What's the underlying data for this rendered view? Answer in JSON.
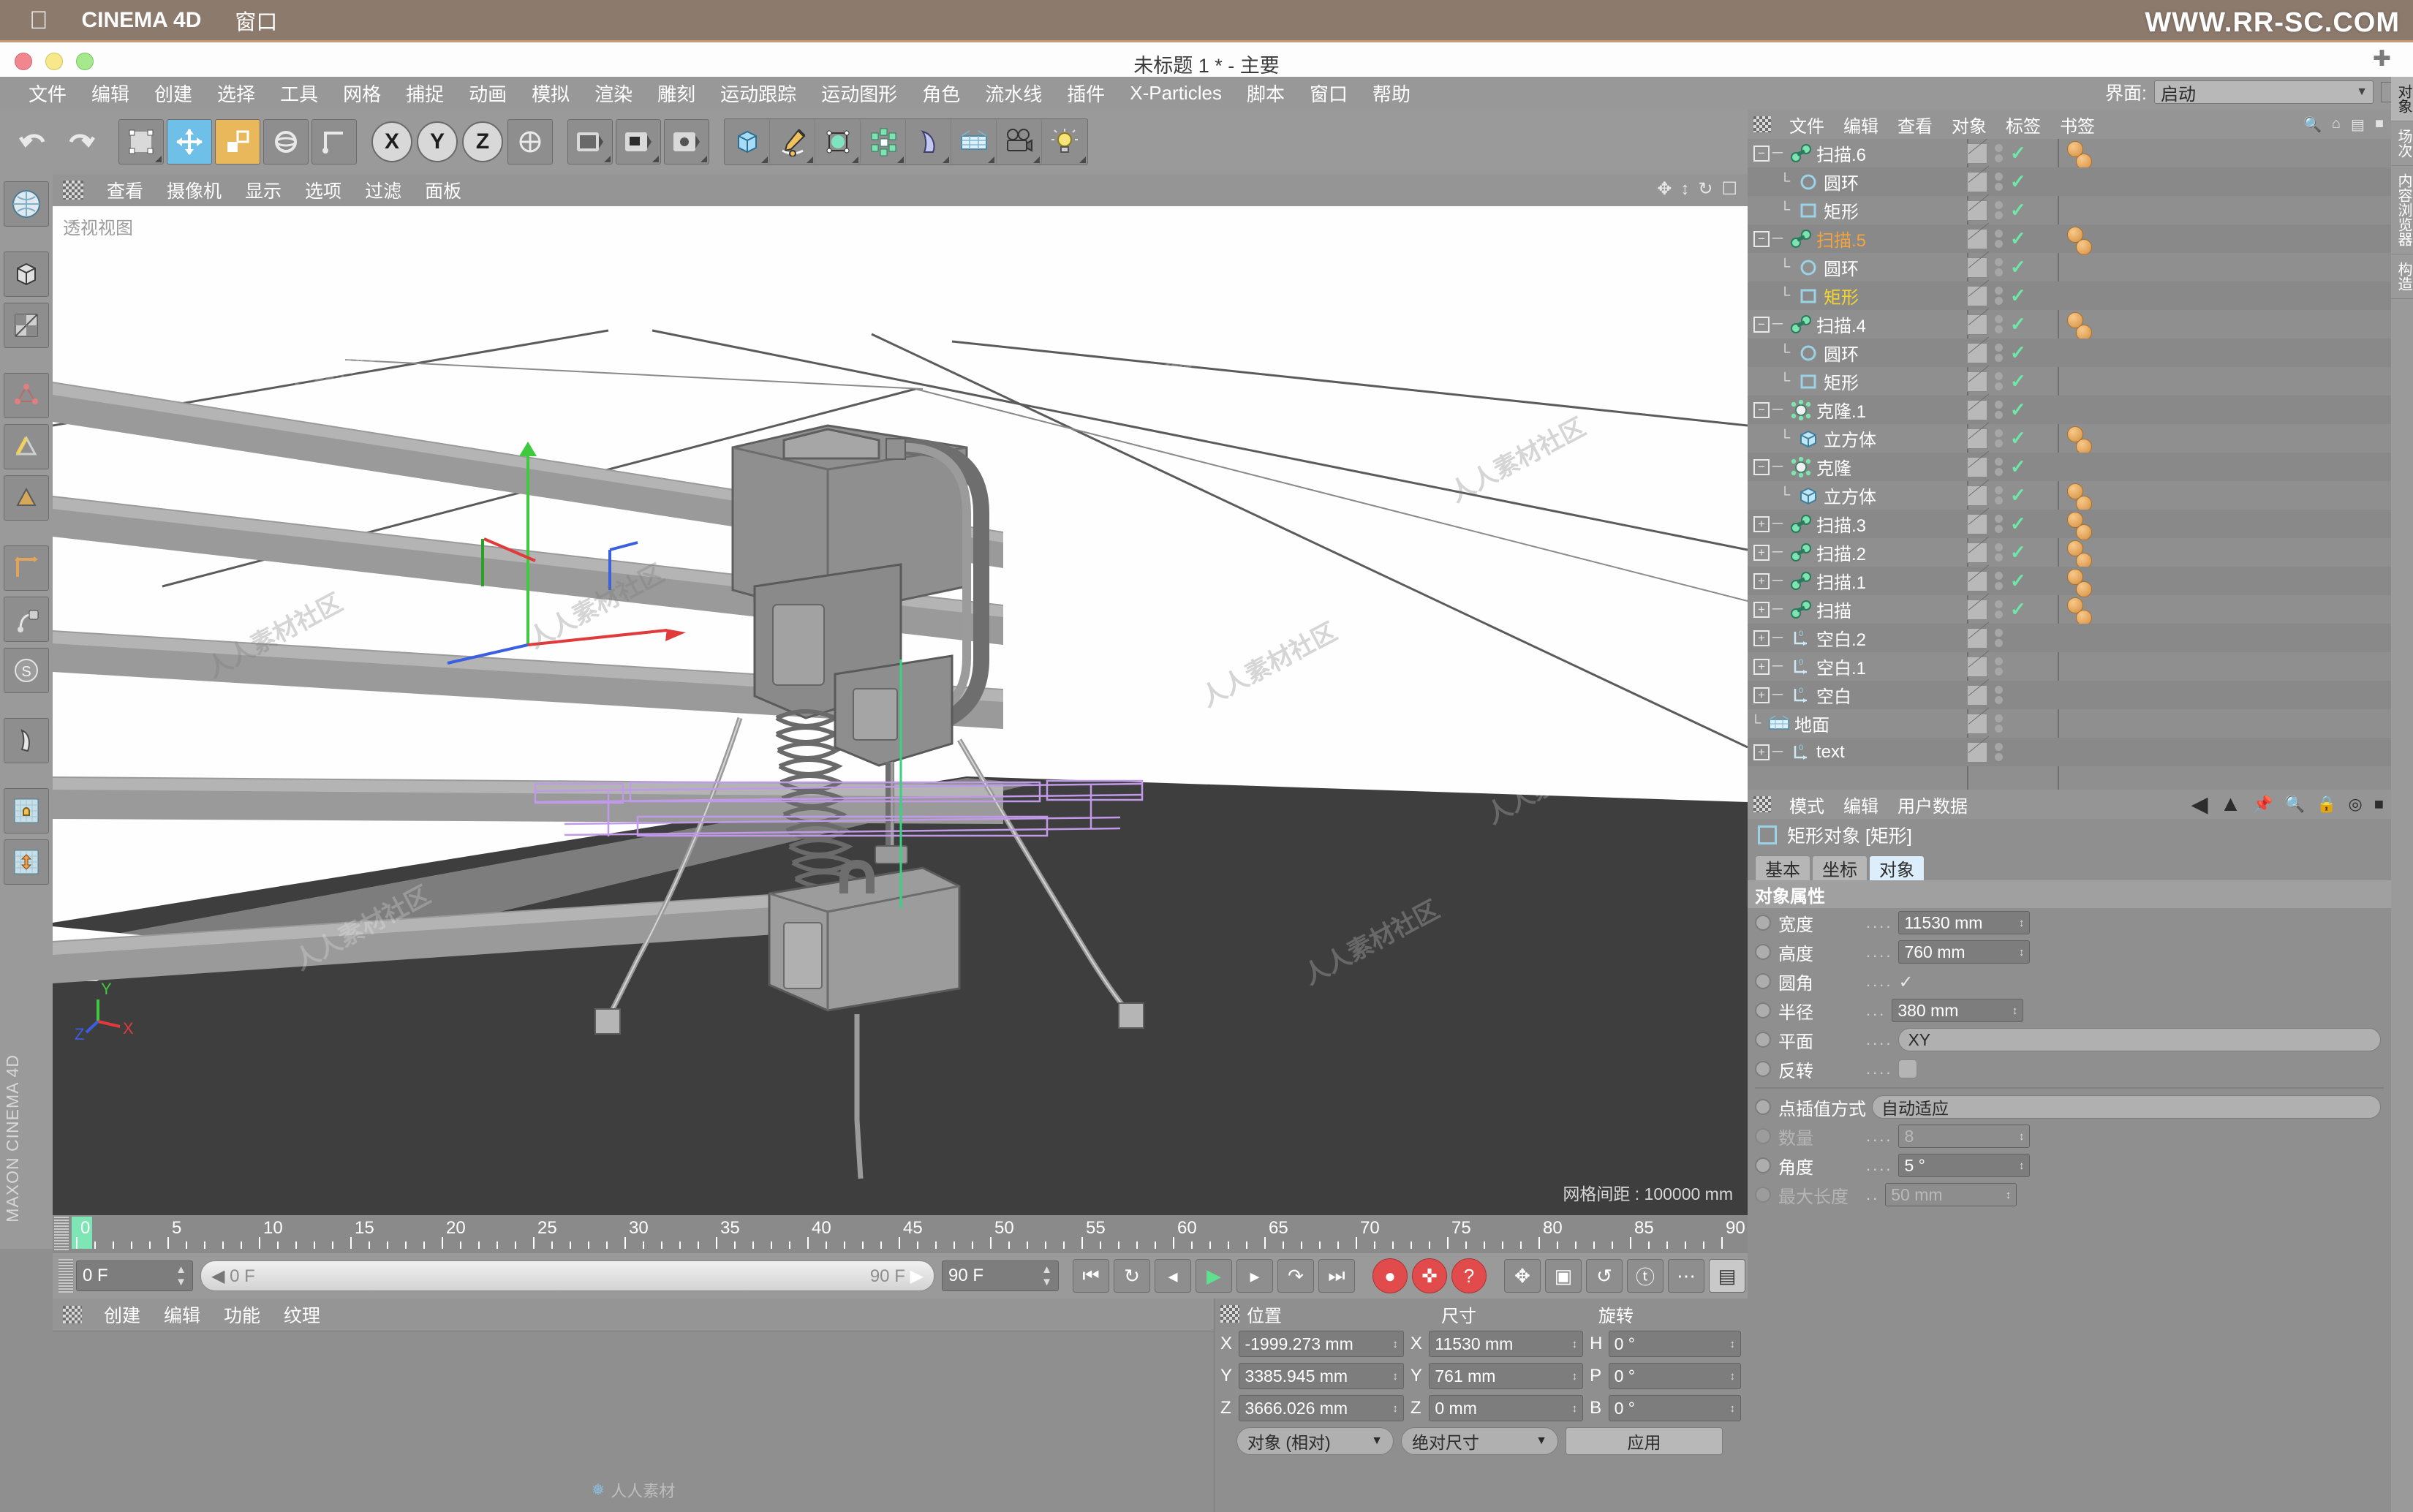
{
  "mac_menu": {
    "apple": "apple-logo",
    "app": "CINEMA 4D",
    "window": "窗口"
  },
  "window": {
    "title": "未标题 1 * - 主要",
    "watermark": "WWW.RR-SC.COM"
  },
  "app_menu": [
    "文件",
    "编辑",
    "创建",
    "选择",
    "工具",
    "网格",
    "捕捉",
    "动画",
    "模拟",
    "渲染",
    "雕刻",
    "运动跟踪",
    "运动图形",
    "角色",
    "流水线",
    "插件",
    "X-Particles",
    "脚本",
    "窗口",
    "帮助"
  ],
  "interface": {
    "label": "界面:",
    "value": "启动"
  },
  "toolbar": {
    "axes": [
      "X",
      "Y",
      "Z"
    ],
    "icons": [
      "undo-icon",
      "redo-icon",
      "live-selection-icon",
      "move-icon",
      "scale-icon",
      "rotate-icon",
      "world-object-icon",
      "render-view-icon",
      "render-region-icon",
      "render-settings-icon",
      "cube-icon",
      "pen-icon",
      "subdivision-surface-icon",
      "array-icon",
      "bend-icon",
      "floor-icon",
      "camera-icon",
      "light-icon"
    ]
  },
  "left_toolbar": {
    "items": [
      "model-mode-icon",
      "texture-mode-icon",
      "points-mode-icon",
      "edges-mode-icon",
      "polygons-mode-icon",
      "axis-mode-icon",
      "enable-axis-icon",
      "viewport-solo-icon",
      "workplane-icon",
      "snap-icon",
      "lock-icon",
      "transform-icon"
    ],
    "brand": "MAXON CINEMA 4D"
  },
  "viewport": {
    "menu": [
      "查看",
      "摄像机",
      "显示",
      "选项",
      "过滤",
      "面板"
    ],
    "label": "透视视图",
    "grid_info": "网格间距 : 100000 mm",
    "axis_labels": {
      "x": "X",
      "y": "Y",
      "z": "Z"
    }
  },
  "timeline": {
    "ticks": [
      "0",
      "5",
      "10",
      "15",
      "20",
      "25",
      "30",
      "35",
      "40",
      "45",
      "50",
      "55",
      "60",
      "65",
      "70",
      "75",
      "80",
      "85",
      "90"
    ],
    "current_frame": "0 F",
    "range_start": "0 F",
    "range_end": "90 F",
    "end_field": "90 F",
    "preview_field": "0 F",
    "transport": [
      "go-to-start-icon",
      "loop-icon",
      "step-back-icon",
      "play-icon",
      "step-forward-icon",
      "go-to-end-record-icon",
      "go-to-end-icon"
    ],
    "record_tools": [
      "record-keyframe-icon",
      "autokey-icon",
      "keyframe-selection-icon",
      "position-key-icon",
      "scale-key-icon",
      "rotation-key-icon",
      "param-key-icon",
      "point-level-key-icon",
      "timeline-icon"
    ]
  },
  "material_manager": {
    "menu": [
      "创建",
      "编辑",
      "功能",
      "纹理"
    ],
    "watermark": "人人素材"
  },
  "coordinates": {
    "headers": {
      "position": "位置",
      "size": "尺寸",
      "rotation": "旋转"
    },
    "rows": [
      {
        "axis": "X",
        "position": "-1999.273 mm",
        "size_axis": "X",
        "size": "11530 mm",
        "rot_axis": "H",
        "rotation": "0 °"
      },
      {
        "axis": "Y",
        "position": "3385.945 mm",
        "size_axis": "Y",
        "size": "761 mm",
        "rot_axis": "P",
        "rotation": "0 °"
      },
      {
        "axis": "Z",
        "position": "3666.026 mm",
        "size_axis": "Z",
        "size": "0 mm",
        "rot_axis": "B",
        "rotation": "0 °"
      }
    ],
    "mode_dropdown": "对象 (相对)",
    "size_dropdown": "绝对尺寸",
    "apply_button": "应用"
  },
  "object_manager": {
    "menu": [
      "文件",
      "编辑",
      "查看",
      "对象",
      "标签",
      "书签"
    ],
    "items": [
      {
        "name": "扫描.6",
        "icon": "sweep-icon",
        "indent": 0,
        "expander": "minus",
        "check": true,
        "tag": true,
        "materials": 2,
        "selected": false
      },
      {
        "name": "圆环",
        "icon": "circle-icon",
        "indent": 1,
        "expander": "none",
        "check": true,
        "tag": true,
        "materials": 0,
        "selected": false
      },
      {
        "name": "矩形",
        "icon": "rect-icon",
        "indent": 1,
        "expander": "none",
        "check": true,
        "tag": true,
        "materials": 0,
        "selected": false
      },
      {
        "name": "扫描.5",
        "icon": "sweep-icon",
        "indent": 0,
        "expander": "minus",
        "check": true,
        "tag": true,
        "materials": 2,
        "selected": true
      },
      {
        "name": "圆环",
        "icon": "circle-icon",
        "indent": 1,
        "expander": "none",
        "check": true,
        "tag": true,
        "materials": 0,
        "selected": false
      },
      {
        "name": "矩形",
        "icon": "rect-icon",
        "indent": 1,
        "expander": "none",
        "check": true,
        "tag": true,
        "materials": 0,
        "selected": "yellow"
      },
      {
        "name": "扫描.4",
        "icon": "sweep-icon",
        "indent": 0,
        "expander": "minus",
        "check": true,
        "tag": true,
        "materials": 2,
        "selected": false
      },
      {
        "name": "圆环",
        "icon": "circle-icon",
        "indent": 1,
        "expander": "none",
        "check": true,
        "tag": true,
        "materials": 0,
        "selected": false
      },
      {
        "name": "矩形",
        "icon": "rect-icon",
        "indent": 1,
        "expander": "none",
        "check": true,
        "tag": true,
        "materials": 0,
        "selected": false
      },
      {
        "name": "克隆.1",
        "icon": "cloner-icon",
        "indent": 0,
        "expander": "minus",
        "check": true,
        "tag": true,
        "materials": 0,
        "selected": false
      },
      {
        "name": "立方体",
        "icon": "cube-icon",
        "indent": 1,
        "expander": "none",
        "check": true,
        "tag": true,
        "materials": 2,
        "selected": false
      },
      {
        "name": "克隆",
        "icon": "cloner-icon",
        "indent": 0,
        "expander": "minus",
        "check": true,
        "tag": true,
        "materials": 0,
        "selected": false
      },
      {
        "name": "立方体",
        "icon": "cube-icon",
        "indent": 1,
        "expander": "none",
        "check": true,
        "tag": true,
        "materials": 2,
        "selected": false
      },
      {
        "name": "扫描.3",
        "icon": "sweep-icon",
        "indent": 0,
        "expander": "plus",
        "check": true,
        "tag": true,
        "materials": 2,
        "selected": false
      },
      {
        "name": "扫描.2",
        "icon": "sweep-icon",
        "indent": 0,
        "expander": "plus",
        "check": true,
        "tag": true,
        "materials": 2,
        "selected": false
      },
      {
        "name": "扫描.1",
        "icon": "sweep-icon",
        "indent": 0,
        "expander": "plus",
        "check": true,
        "tag": true,
        "materials": 2,
        "selected": false
      },
      {
        "name": "扫描",
        "icon": "sweep-icon",
        "indent": 0,
        "expander": "plus",
        "check": true,
        "tag": true,
        "materials": 2,
        "selected": false
      },
      {
        "name": "空白.2",
        "icon": "null-icon",
        "indent": 0,
        "expander": "plus",
        "check": false,
        "tag": true,
        "materials": 0,
        "selected": false
      },
      {
        "name": "空白.1",
        "icon": "null-icon",
        "indent": 0,
        "expander": "plus",
        "check": false,
        "tag": true,
        "materials": 0,
        "selected": false
      },
      {
        "name": "空白",
        "icon": "null-icon",
        "indent": 0,
        "expander": "plus",
        "check": false,
        "tag": true,
        "materials": 0,
        "selected": false
      },
      {
        "name": "地面",
        "icon": "floor-icon",
        "indent": 0,
        "expander": "none",
        "check": false,
        "tag": true,
        "materials": 0,
        "selected": false
      },
      {
        "name": "text",
        "icon": "null-icon",
        "indent": 0,
        "expander": "plus",
        "check": false,
        "tag": true,
        "materials": 0,
        "selected": false
      }
    ]
  },
  "attribute_manager": {
    "menu": [
      "模式",
      "编辑",
      "用户数据"
    ],
    "object_title": "矩形对象 [矩形]",
    "tabs": [
      {
        "label": "基本",
        "active": false
      },
      {
        "label": "坐标",
        "active": false
      },
      {
        "label": "对象",
        "active": true
      }
    ],
    "section_title": "对象属性",
    "properties": [
      {
        "label": "宽度",
        "dots": "....",
        "type": "field",
        "value": "11530 mm",
        "dim": false
      },
      {
        "label": "高度",
        "dots": "....",
        "type": "field",
        "value": "760 mm",
        "dim": false
      },
      {
        "label": "圆角",
        "dots": "....",
        "type": "check",
        "value": "✓",
        "dim": false
      },
      {
        "label": "半径",
        "dots": "...",
        "type": "field",
        "value": "380 mm",
        "dim": false
      },
      {
        "label": "平面",
        "dots": "....",
        "type": "wide",
        "value": "XY",
        "dim": false
      },
      {
        "label": "反转",
        "dots": "....",
        "type": "toggle",
        "value": "",
        "dim": false
      },
      {
        "label": "点插值方式",
        "dots": "",
        "type": "wide",
        "value": "自动适应",
        "dim": false
      },
      {
        "label": "数量",
        "dots": "....",
        "type": "field",
        "value": "8",
        "dim": true
      },
      {
        "label": "角度",
        "dots": "....",
        "type": "field",
        "value": "5 °",
        "dim": false
      },
      {
        "label": "最大长度",
        "dots": "..",
        "type": "field",
        "value": "50 mm",
        "dim": true
      }
    ]
  },
  "right_tabs": [
    "对象",
    "场次",
    "内容浏览器",
    "构造"
  ],
  "colors": {
    "accent_orange": "#f5a33c",
    "accent_yellow": "#f3d52e",
    "check_green": "#6ee8a8",
    "panel_gray": "#8f8f8f",
    "toolbar_gray": "#9a9a9a",
    "titlebar_brown": "#8c7a6d",
    "tab_active": "#dceefb"
  }
}
